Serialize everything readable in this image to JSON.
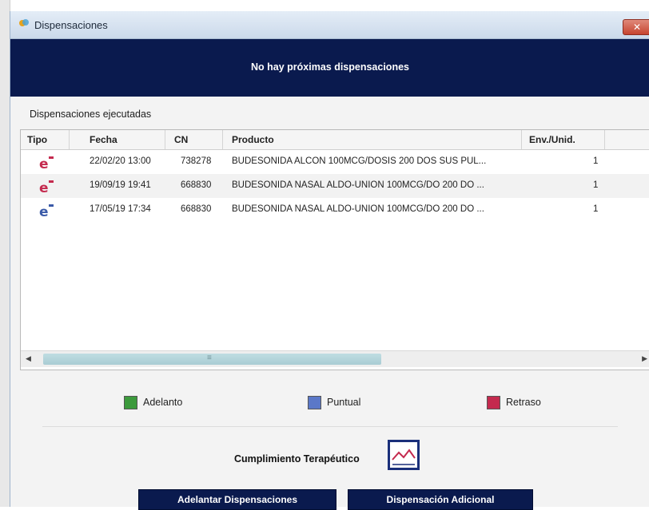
{
  "window": {
    "title": "Dispensaciones",
    "close_label": "✕"
  },
  "banner": {
    "text": "No hay próximas dispensaciones"
  },
  "section": {
    "label": "Dispensaciones ejecutadas"
  },
  "table": {
    "columns": [
      "Tipo",
      "Fecha",
      "CN",
      "Producto",
      "Env./Unid."
    ],
    "rows": [
      {
        "tipo": "retraso",
        "fecha": "22/02/20 13:00",
        "cn": "738278",
        "producto": "BUDESONIDA ALCON 100MCG/DOSIS 200 DOS SUS PUL...",
        "env": "1"
      },
      {
        "tipo": "retraso",
        "fecha": "19/09/19 19:41",
        "cn": "668830",
        "producto": "BUDESONIDA NASAL ALDO-UNION 100MCG/DO 200 DO ...",
        "env": "1"
      },
      {
        "tipo": "puntual",
        "fecha": "17/05/19 17:34",
        "cn": "668830",
        "producto": "BUDESONIDA NASAL ALDO-UNION 100MCG/DO 200 DO ...",
        "env": "1"
      }
    ]
  },
  "legend": [
    {
      "label": "Adelanto",
      "color": "#3c9a3c"
    },
    {
      "label": "Puntual",
      "color": "#5b78c8"
    },
    {
      "label": "Retraso",
      "color": "#c42a4e"
    }
  ],
  "cumplimiento": {
    "label": "Cumplimiento Terapéutico",
    "icon": "line-chart-icon"
  },
  "buttons": {
    "adelantar": "Adelantar Dispensaciones",
    "adicional": "Dispensación Adicional"
  },
  "colors": {
    "banner_bg": "#0a1a4e",
    "icon_red": "#c42a4e",
    "icon_blue": "#3a5aa8"
  }
}
